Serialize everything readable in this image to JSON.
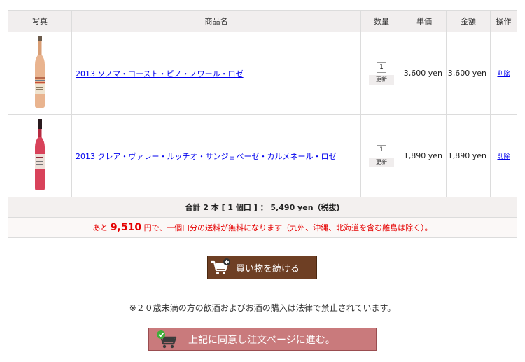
{
  "table": {
    "headers": {
      "photo": "写真",
      "name": "商品名",
      "qty": "数量",
      "unit_price": "単価",
      "amount": "金額",
      "op": "操作"
    },
    "rows": [
      {
        "name": "2013 ソノマ・コースト・ピノ・ノワール・ロゼ",
        "qty": "1",
        "update_label": "更新",
        "unit_price": "3,600 yen",
        "amount": "3,600 yen",
        "delete_label": "削除",
        "bottle_color": "#e9b48f"
      },
      {
        "name": "2013 クレア・ヴァレー・ルッチオ・サンジョベーゼ・カルメネール・ロゼ",
        "qty": "1",
        "update_label": "更新",
        "unit_price": "1,890 yen",
        "amount": "1,890 yen",
        "delete_label": "削除",
        "bottle_color": "#d8425a"
      }
    ],
    "total_text": "合計 2 本 [ 1 個口 ] ： 5,490 yen（税抜)",
    "notice": {
      "prefix": "あと ",
      "amount": "9,510",
      "suffix": " 円で、一個口分の送料が無料になります（九州、沖縄、北海道を含む離島は除く）。"
    }
  },
  "continue_button": {
    "label": "買い物を続ける"
  },
  "legal_text": "※２０歳未満の方の飲酒およびお酒の購入は法律で禁止されています。",
  "proceed_button": {
    "label": "上記に同意し注文ページに進む。"
  },
  "colors": {
    "continue_bg": "#6e3f24",
    "proceed_bg": "#c97a7c",
    "notice_red": "#e50000"
  }
}
